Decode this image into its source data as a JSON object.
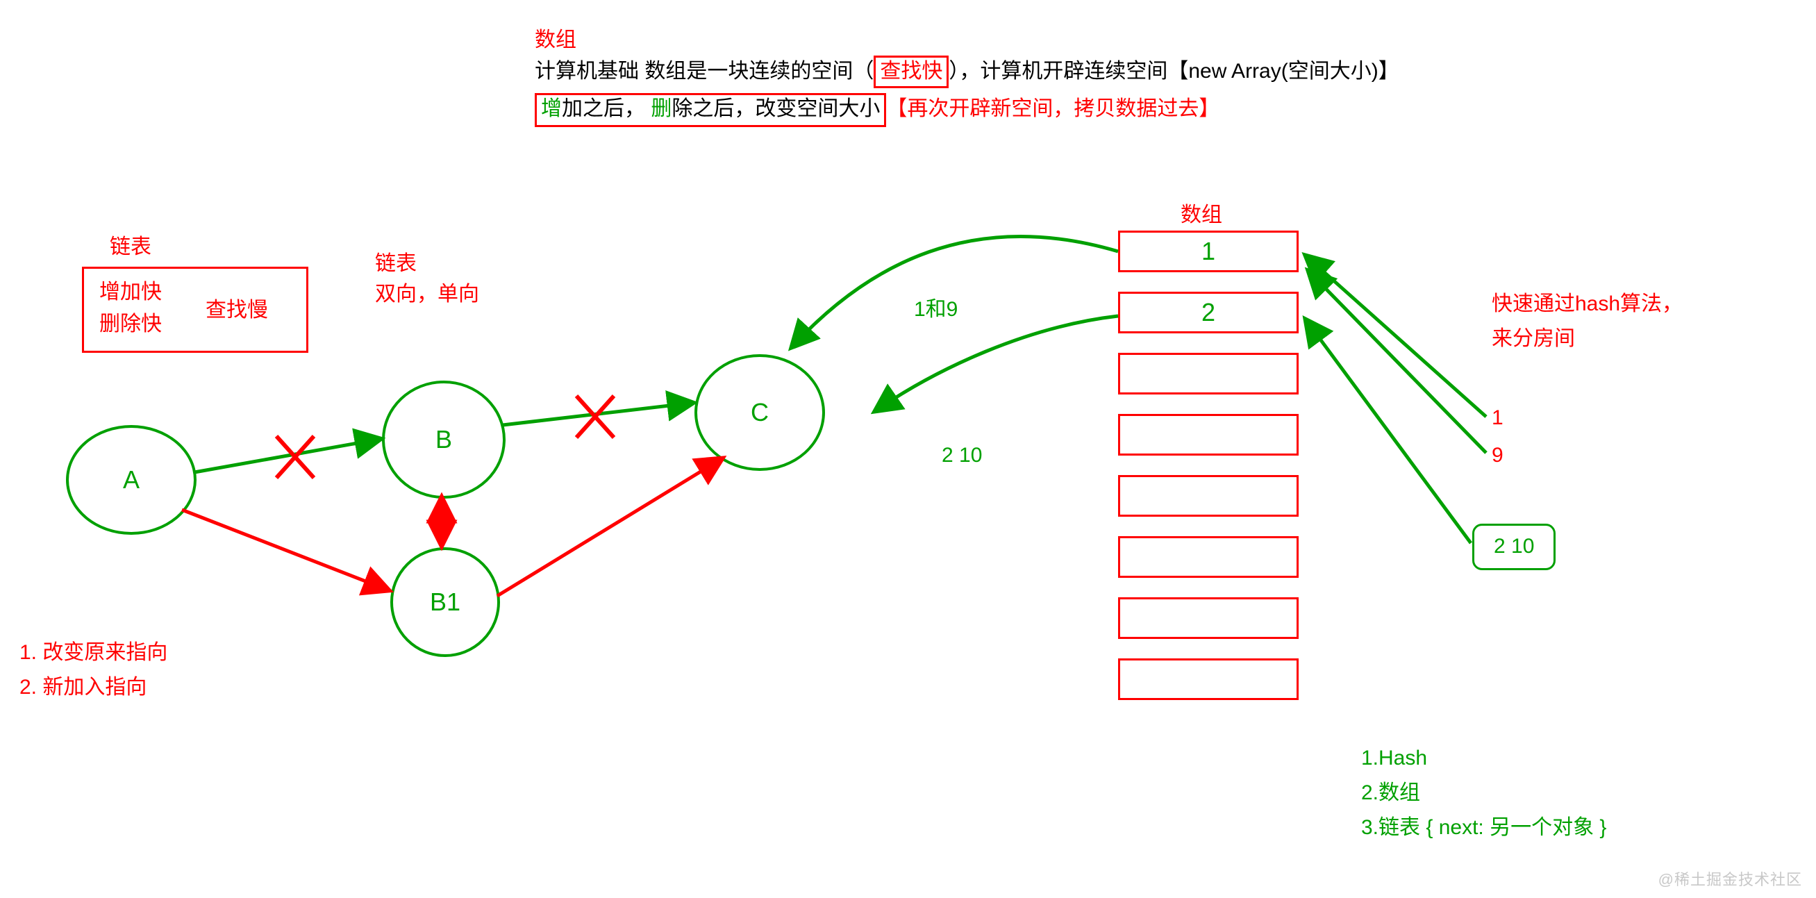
{
  "header": {
    "title_array": "数组",
    "line1_prefix": "计算机基础  数组是一块连续的空间（",
    "line1_highlight": "查找快",
    "line1_suffix": "），计算机开辟连续空间【new Array(空间大小)】",
    "line2_add": "增",
    "line2_add_after": "加之后，",
    "line2_del": "删",
    "line2_del_after": "除之后，改变空间大小",
    "line2_brackets": "【再次开辟新空间，拷贝数据过去】"
  },
  "linked_list": {
    "label_main": "链表",
    "box_add_fast": "增加快",
    "box_del_fast": "删除快",
    "box_find_slow": "查找慢",
    "label_sub_title": "链表",
    "label_sub_dir": "双向，单向",
    "node_a": "A",
    "node_b": "B",
    "node_b1": "B1",
    "node_c": "C",
    "steps_line1": "1. 改变原来指向",
    "steps_line2": "2. 新加入指向"
  },
  "array_block": {
    "title": "数组",
    "cells": [
      "1",
      "2",
      "",
      "",
      "",
      "",
      "",
      ""
    ],
    "edge_label_1_9": "1和9",
    "edge_label_2_10": "2 10"
  },
  "hash": {
    "desc_line1": "快速通过hash算法，",
    "desc_line2": "来分房间",
    "in_1": "1",
    "in_9": "9",
    "in_2_10": "2 10",
    "summary_1": "1.Hash",
    "summary_2": "2.数组",
    "summary_3": "3.链表 {  next: 另一个对象 }"
  },
  "watermark": "@稀土掘金技术社区"
}
